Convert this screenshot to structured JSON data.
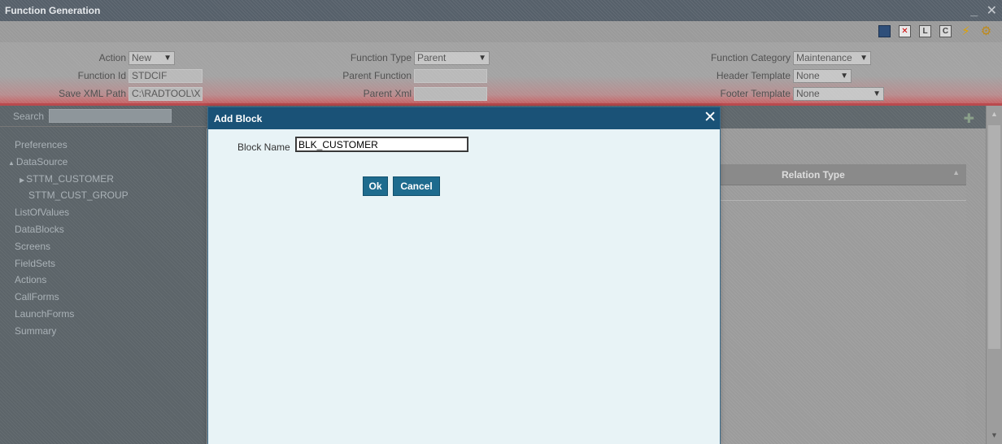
{
  "window": {
    "title": "Function Generation",
    "minimize_glyph": "_",
    "close_glyph": "✕"
  },
  "toolbar": {
    "icons": [
      "save-icon",
      "delete-icon",
      "L-icon",
      "C-icon",
      "lightning-icon",
      "deploy-icon"
    ],
    "l_label": "L",
    "c_label": "C",
    "x_label": "✕"
  },
  "header": {
    "action_label": "Action",
    "action_value": "New",
    "function_id_label": "Function Id",
    "function_id_value": "STDCIF",
    "save_xml_path_label": "Save XML Path",
    "save_xml_path_value": "C:\\RADTOOL\\X",
    "function_type_label": "Function Type",
    "function_type_value": "Parent",
    "parent_function_label": "Parent Function",
    "parent_function_value": "",
    "parent_xml_label": "Parent Xml",
    "parent_xml_value": "",
    "function_category_label": "Function Category",
    "function_category_value": "Maintenance",
    "header_template_label": "Header Template",
    "header_template_value": "None",
    "footer_template_label": "Footer Template",
    "footer_template_value": "None"
  },
  "sidebar": {
    "search_label": "Search",
    "items": [
      {
        "label": "Preferences"
      },
      {
        "label": "DataSource"
      },
      {
        "label": "STTM_CUSTOMER"
      },
      {
        "label": "STTM_CUST_GROUP"
      },
      {
        "label": "ListOfValues"
      },
      {
        "label": "DataBlocks"
      },
      {
        "label": "Screens"
      },
      {
        "label": "FieldSets"
      },
      {
        "label": "Actions"
      },
      {
        "label": "CallForms"
      },
      {
        "label": "LaunchForms"
      },
      {
        "label": "Summary"
      }
    ]
  },
  "grid": {
    "column_relation_type": "Relation Type"
  },
  "dialog": {
    "title": "Add Block",
    "close_glyph": "✕",
    "block_name_label": "Block Name",
    "block_name_value": "BLK_CUSTOMER",
    "ok_label": "Ok",
    "cancel_label": "Cancel"
  }
}
